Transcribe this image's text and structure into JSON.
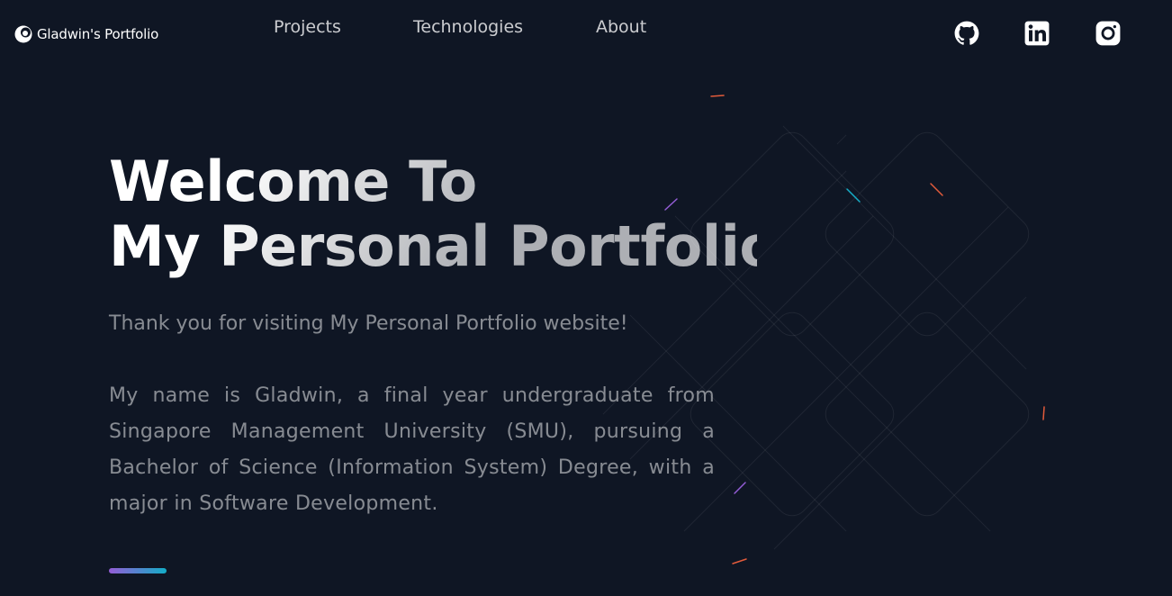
{
  "header": {
    "logo_text": "Gladwin's Portfolio",
    "nav": [
      {
        "label": "Projects"
      },
      {
        "label": "Technologies"
      },
      {
        "label": "About"
      }
    ],
    "social": [
      {
        "icon": "github-icon"
      },
      {
        "icon": "linkedin-icon"
      },
      {
        "icon": "instagram-icon"
      }
    ]
  },
  "hero": {
    "title_line1": "Welcome To",
    "title_line2": "My Personal Portfolio",
    "subtitle": "Thank you for visiting My Personal Portfolio website!",
    "bio": "My name is Gladwin, a final year undergraduate from Singapore Management University (SMU), pursuing a Bachelor of Science (Information System) Degree, with a major in Software Development."
  },
  "colors": {
    "background": "#0f1624",
    "accent_start": "#945dd6",
    "accent_end": "#13adc7",
    "text_primary": "#ffffff",
    "text_muted": "rgba(255,255,255,0.5)"
  }
}
